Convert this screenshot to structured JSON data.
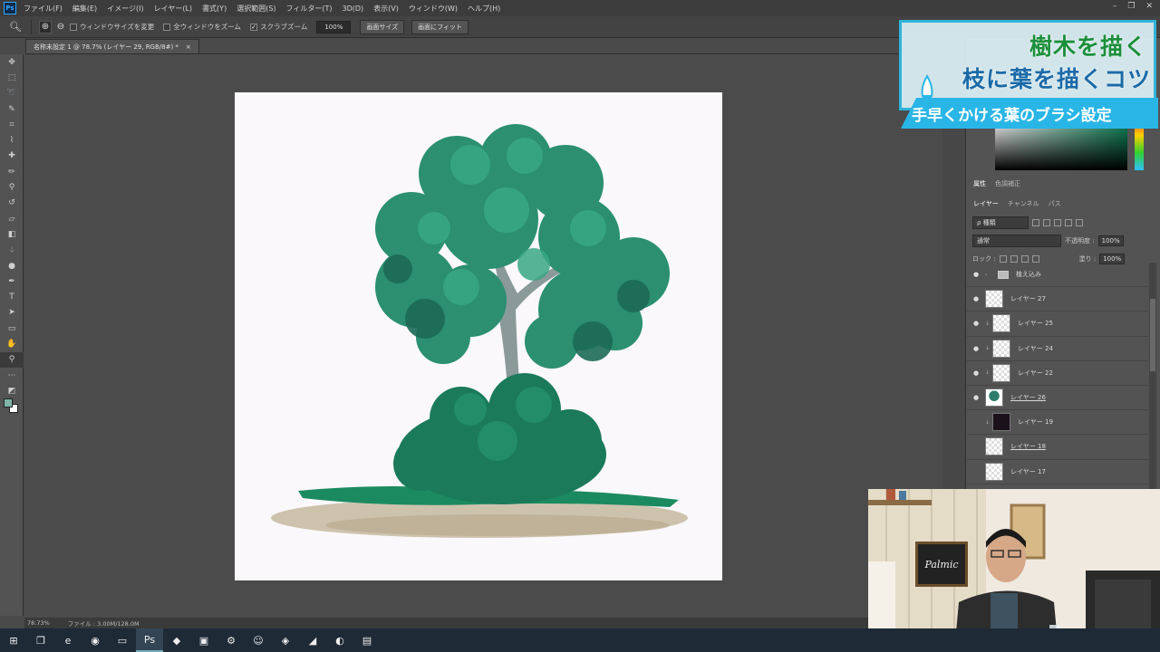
{
  "menubar": {
    "items": [
      "ファイル(F)",
      "編集(E)",
      "イメージ(I)",
      "レイヤー(L)",
      "書式(Y)",
      "選択範囲(S)",
      "フィルター(T)",
      "3D(D)",
      "表示(V)",
      "ウィンドウ(W)",
      "ヘルプ(H)"
    ]
  },
  "options": {
    "resize_windows": "ウィンドウサイズを変更",
    "zoom_all": "全ウィンドウをズーム",
    "scrubby_zoom": "スクラブズーム",
    "zoom_value": "100%",
    "fit_screen": "画面サイズ",
    "fill_screen": "画面にフィット"
  },
  "document": {
    "tab_title": "名称未設定 1 @ 78.7% (レイヤー 29, RGB/8#) *",
    "close": "×"
  },
  "statusbar": {
    "zoom": "78.73%",
    "file_info": "ファイル : 3.00M/128.0M"
  },
  "panels": {
    "props_tabs": [
      "属性",
      "色調補正"
    ],
    "layer_tabs": [
      "レイヤー",
      "チャンネル",
      "パス"
    ],
    "kind": "ρ 種類",
    "blend_mode": "通常",
    "opacity_label": "不透明度 :",
    "opacity_value": "100%",
    "lock_label": "ロック :",
    "fill_label": "塗り :",
    "fill_value": "100%"
  },
  "layers": [
    {
      "name": "植え込み",
      "type": "folder",
      "visible": true,
      "clip": false
    },
    {
      "name": "レイヤー 27",
      "type": "layer",
      "visible": true,
      "clip": false
    },
    {
      "name": "レイヤー 25",
      "type": "layer",
      "visible": true,
      "clip": true
    },
    {
      "name": "レイヤー 24",
      "type": "layer",
      "visible": true,
      "clip": true
    },
    {
      "name": "レイヤー 22",
      "type": "layer",
      "visible": true,
      "clip": true
    },
    {
      "name": "レイヤー 26",
      "type": "tree",
      "visible": true,
      "clip": false
    },
    {
      "name": "レイヤー 19",
      "type": "dark",
      "visible": false,
      "clip": true
    },
    {
      "name": "レイヤー 18",
      "type": "layer",
      "visible": false,
      "clip": false
    },
    {
      "name": "レイヤー 17",
      "type": "layer",
      "visible": false,
      "clip": false
    }
  ],
  "overlay": {
    "line1": "樹木を描く",
    "line2": "枝に葉を描くコツ",
    "banner": "手早くかける葉のブラシ設定"
  },
  "webcam": {
    "sign": "Palmic"
  },
  "colors": {
    "foreground": "#7fb6a8",
    "background": "#ffffff",
    "accent_blue": "#29b6e6",
    "title_green": "#1b8f3a",
    "title_blue": "#1b6aa8"
  },
  "icons": {
    "layer_visible": "eye-icon",
    "window_minimize": "minimize-icon",
    "window_restore": "restore-icon",
    "window_close": "close-icon"
  }
}
